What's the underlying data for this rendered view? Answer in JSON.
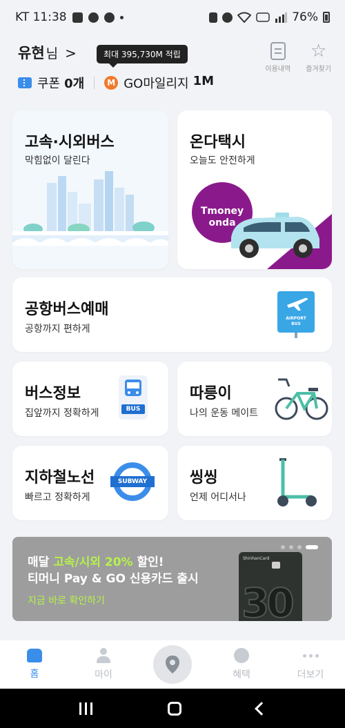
{
  "status_bar": {
    "carrier_time": "KT 11:38",
    "battery": "76%"
  },
  "header": {
    "user_name": "유현",
    "user_suffix": "님",
    "tooltip": "최대 395,730M 적립",
    "history_label": "이용내역",
    "favorites_label": "즐겨찾기",
    "coupon_label": "쿠폰",
    "coupon_count": "0개",
    "mileage_label": "GO마일리지",
    "mileage_value": "1M"
  },
  "cards": {
    "express": {
      "title": "고속·시외버스",
      "sub": "막힘없이 달린다"
    },
    "taxi": {
      "title": "온다택시",
      "sub": "오늘도 안전하게",
      "brand_line1": "Tmoney",
      "brand_line2": "onda"
    },
    "airport": {
      "title": "공항버스예매",
      "sub": "공항까지 편하게",
      "badge1": "AIRPORT",
      "badge2": "BUS"
    },
    "businfo": {
      "title": "버스정보",
      "sub": "집앞까지 정확하게",
      "badge": "BUS"
    },
    "bike": {
      "title": "따릉이",
      "sub": "나의 운동 메이트"
    },
    "subway": {
      "title": "지하철노선",
      "sub": "빠르고 정확하게",
      "badge": "SUBWAY"
    },
    "scooter": {
      "title": "씽씽",
      "sub": "언제 어디서나"
    }
  },
  "banner": {
    "line1_prefix": "매달 ",
    "line1_highlight": "고속/시외 20%",
    "line1_suffix": " 할인!",
    "line2": "티머니 Pay & GO 신용카드 출시",
    "link": "지금 바로 확인하기",
    "card_brand": "ShinhanCard",
    "card_number": "30"
  },
  "bottom_nav": {
    "home": "홈",
    "my": "마이",
    "benefit": "혜택",
    "more": "더보기"
  },
  "colors": {
    "accent": "#3b8dea",
    "taxi_purple": "#8a1a8c",
    "banner_bg": "#9d9d9d",
    "banner_highlight": "#b6f24a"
  }
}
